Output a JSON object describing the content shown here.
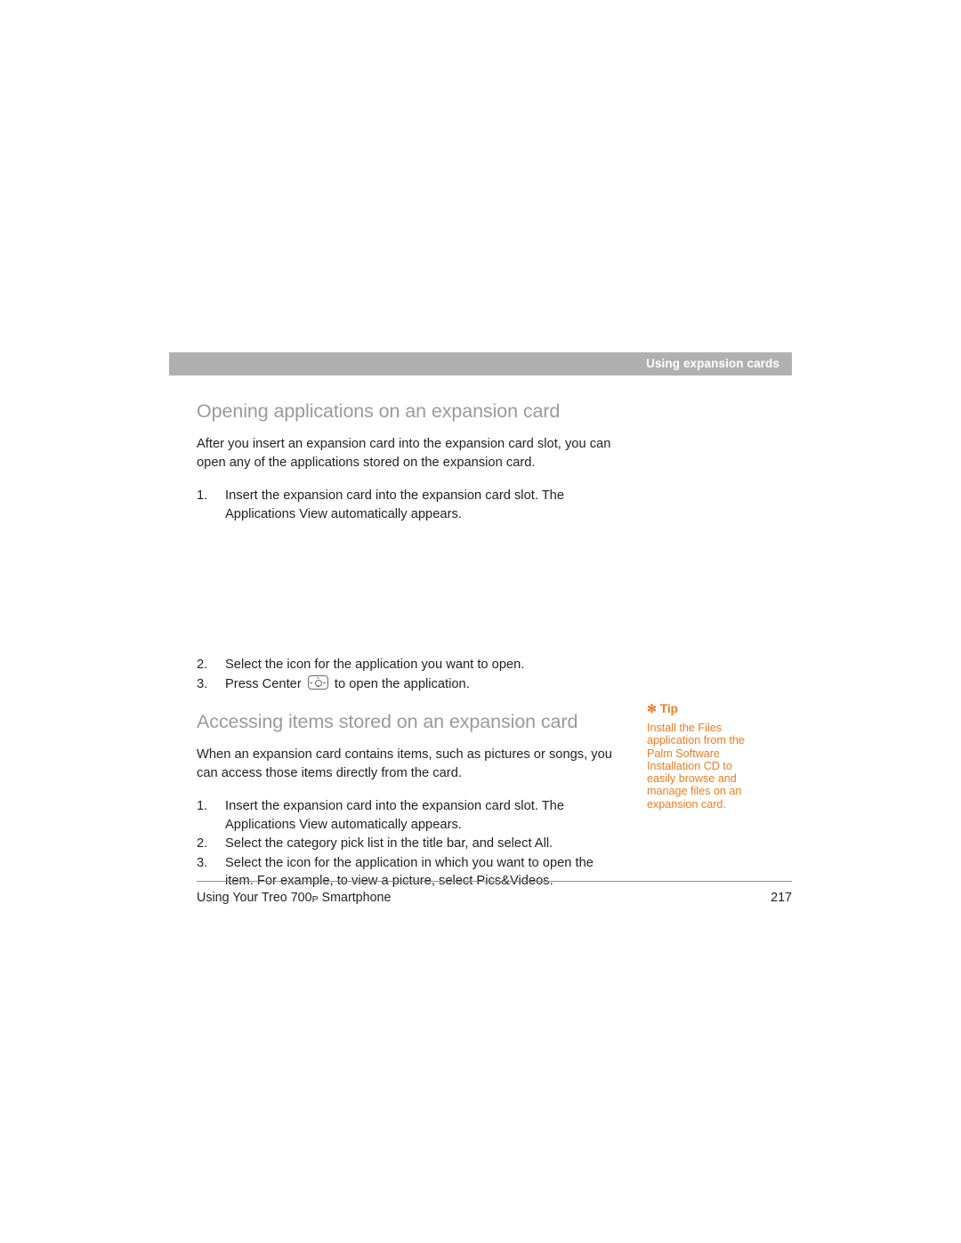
{
  "header": {
    "running_head": "Using expansion cards"
  },
  "sections": [
    {
      "title": "Opening applications on an expansion card",
      "intro": "After you insert an expansion card into the expansion card slot, you can open any of the applications stored on the expansion card.",
      "steps_before_gap": [
        {
          "num": "1.",
          "text": "Insert the expansion card into the expansion card slot. The Applications View automatically appears."
        }
      ],
      "steps_after_gap": [
        {
          "num": "2.",
          "text": "Select the icon for the application you want to open."
        },
        {
          "num": "3.",
          "text_before": "Press Center",
          "icon": "center-key-icon",
          "text_after": "to open the application."
        }
      ]
    },
    {
      "title": "Accessing items stored on an expansion card",
      "intro": "When an expansion card contains items, such as pictures or songs, you can access those items directly from the card.",
      "steps": [
        {
          "num": "1.",
          "text": "Insert the expansion card into the expansion card slot. The Applications View automatically appears."
        },
        {
          "num": "2.",
          "text": "Select the category pick list in the title bar, and select All."
        },
        {
          "num": "3.",
          "text": "Select the icon for the application in which you want to open the item. For example, to view a picture, select Pics&Videos."
        }
      ]
    }
  ],
  "tip": {
    "star": "✻",
    "label": "Tip",
    "body": "Install the Files application from the Palm Software Installation CD to easily browse and manage files on an expansion card."
  },
  "footer": {
    "title_main": "Using Your Treo 700",
    "title_sub": "P",
    "title_tail": " Smartphone",
    "page_number": "217"
  },
  "colors": {
    "header_bar": "#b0b0b0",
    "heading": "#9a9a9a",
    "tip_accent": "#f07c1e",
    "body_text": "#221f1f"
  }
}
